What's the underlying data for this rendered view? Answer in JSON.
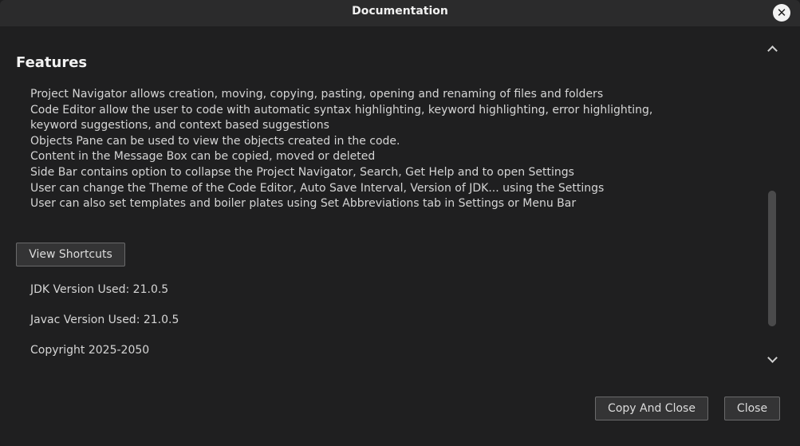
{
  "window": {
    "title": "Documentation",
    "close_symbol": "✕"
  },
  "features": {
    "title": "Features",
    "items": [
      "Project Navigator allows creation, moving, copying, pasting, opening and renaming of files and folders",
      "Code Editor allow the user to code with automatic syntax highlighting, keyword highlighting, error highlighting, keyword suggestions, and context based suggestions",
      "Objects Pane can be used to view the objects created in the code.",
      "Content in the Message Box can be copied, moved or deleted",
      "Side Bar contains option to collapse the Project Navigator, Search, Get Help and to open Settings",
      "User can change the Theme of the Code Editor, Auto Save Interval, Version of JDK... using the Settings",
      "User can also set templates and boiler plates using Set Abbreviations tab in Settings or Menu Bar"
    ]
  },
  "buttons": {
    "view_shortcuts": "View Shortcuts",
    "copy_and_close": "Copy And Close",
    "close": "Close"
  },
  "info": {
    "jdk_version": "JDK Version Used: 21.0.5",
    "javac_version": "Javac Version Used: 21.0.5",
    "copyright": "Copyright 2025-2050"
  },
  "icons": {
    "close": "close-icon",
    "scroll_up": "chevron-up-icon",
    "scroll_down": "chevron-down-icon"
  },
  "colors": {
    "background": "#1f1f20",
    "titlebar": "#2b2b2c",
    "button_bg": "#343435",
    "button_border": "#6a6a6b",
    "text": "#d5d5d5"
  }
}
